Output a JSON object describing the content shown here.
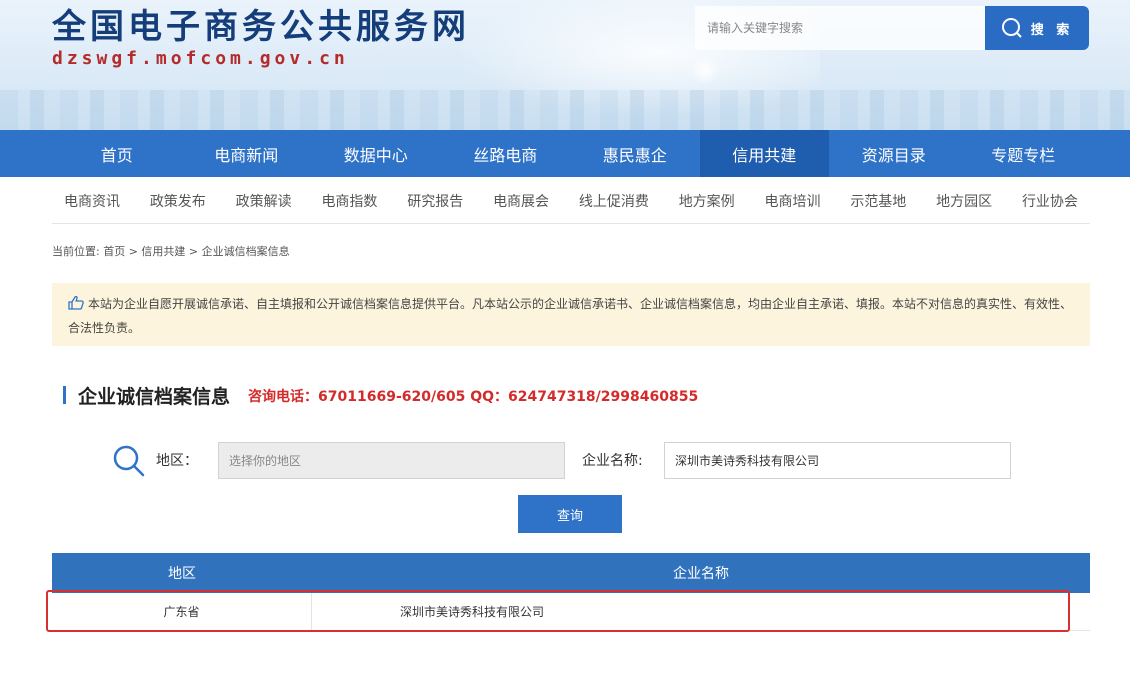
{
  "header": {
    "site_title": "全国电子商务公共服务网",
    "site_domain": "dzswgf.mofcom.gov.cn",
    "search_placeholder": "请输入关键字搜索",
    "search_button": "搜 索"
  },
  "main_nav": {
    "items": [
      "首页",
      "电商新闻",
      "数据中心",
      "丝路电商",
      "惠民惠企",
      "信用共建",
      "资源目录",
      "专题专栏"
    ],
    "active": "信用共建"
  },
  "sub_nav": {
    "items": [
      "电商资讯",
      "政策发布",
      "政策解读",
      "电商指数",
      "研究报告",
      "电商展会",
      "线上促消费",
      "地方案例",
      "电商培训",
      "示范基地",
      "地方园区",
      "行业协会"
    ]
  },
  "breadcrumb": "当前位置: 首页 > 信用共建 > 企业诚信档案信息",
  "notice": "本站为企业自愿开展诚信承诺、自主填报和公开诚信档案信息提供平台。凡本站公示的企业诚信承诺书、企业诚信档案信息，均由企业自主承诺、填报。本站不对信息的真实性、有效性、合法性负责。",
  "section": {
    "title": "企业诚信档案信息",
    "contact": "咨询电话：67011669-620/605 QQ：624747318/2998460855"
  },
  "search_form": {
    "region_label": "地区：",
    "region_placeholder": "选择你的地区",
    "company_label": "企业名称:",
    "company_value": "深圳市美诗秀科技有限公司",
    "query_button": "查询"
  },
  "results": {
    "columns": [
      "地区",
      "企业名称"
    ],
    "rows": [
      [
        "广东省",
        "深圳市美诗秀科技有限公司"
      ]
    ]
  },
  "colors": {
    "nav_blue": "#2f73c9",
    "nav_active": "#1f5daf",
    "contact_red": "#d42a2a",
    "notice_bg": "#fdf4dd",
    "highlight_red": "#d63030"
  }
}
